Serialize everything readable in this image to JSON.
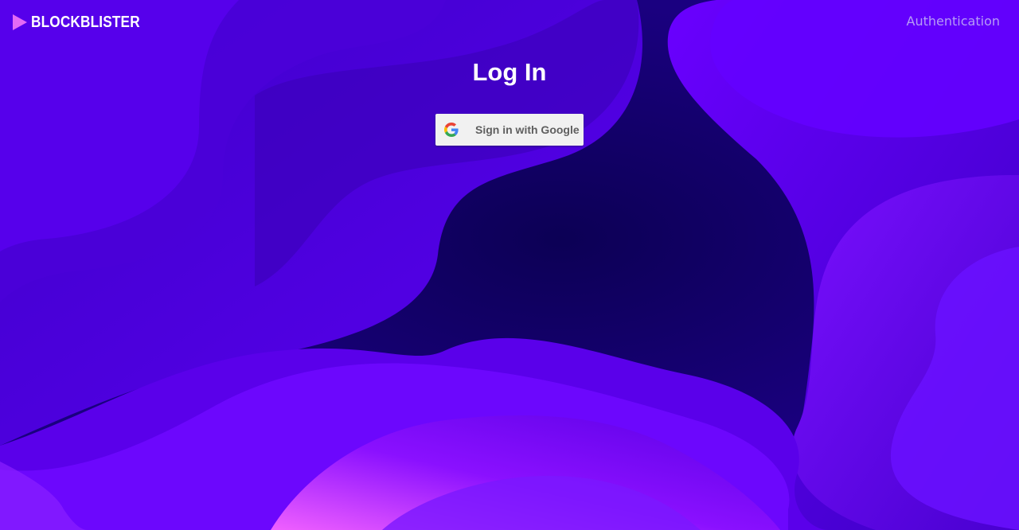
{
  "header": {
    "brand_name": "BLOCKBLISTER",
    "brand_icon": "play-triangle-icon",
    "nav_link": "Authentication"
  },
  "main": {
    "title": "Log In",
    "google_button": {
      "label": "Sign in with Google",
      "icon": "google-logo-icon"
    }
  },
  "colors": {
    "background_base": "#13006b",
    "brand_icon": "#e46af5",
    "nav_link": "#b69cf6",
    "button_bg": "#f1f1f1",
    "button_text": "#5f5f5f"
  }
}
